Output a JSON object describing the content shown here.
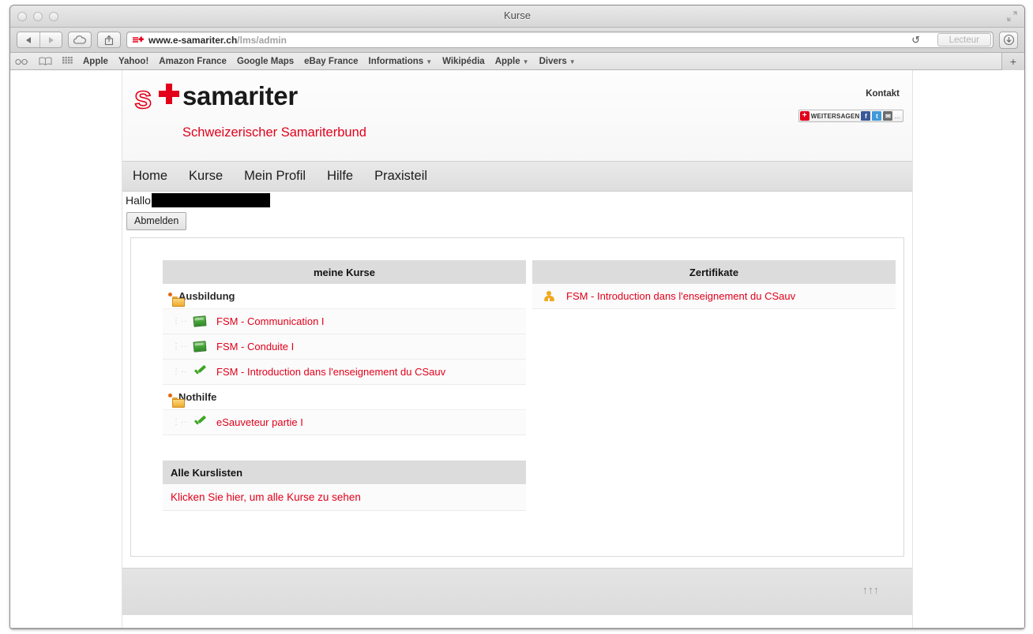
{
  "window": {
    "title": "Kurse",
    "fullscreen_icon": "fullscreen-icon"
  },
  "toolbar": {
    "back_icon": "back-arrow-icon",
    "forward_icon": "forward-arrow-icon",
    "icloud_icon": "cloud-icon",
    "share_icon": "share-icon",
    "url_favicon": "samariter-favicon",
    "url_host": "www.e-samariter.ch",
    "url_path": "/lms/admin",
    "reload_icon": "reload-icon",
    "reader_label": "Lecteur",
    "downloads_icon": "download-icon"
  },
  "bookmarks": {
    "reading_list_icon": "glasses-icon",
    "bookmarks_icon": "book-icon",
    "top_sites_icon": "grid-icon",
    "items": [
      {
        "label": "Apple",
        "has_caret": false
      },
      {
        "label": "Yahoo!",
        "has_caret": false
      },
      {
        "label": "Amazon France",
        "has_caret": false
      },
      {
        "label": "Google Maps",
        "has_caret": false
      },
      {
        "label": "eBay France",
        "has_caret": false
      },
      {
        "label": "Informations",
        "has_caret": true
      },
      {
        "label": "Wikipédia",
        "has_caret": false
      },
      {
        "label": "Apple",
        "has_caret": true
      },
      {
        "label": "Divers",
        "has_caret": true
      }
    ],
    "new_tab_label": "+"
  },
  "site": {
    "logo_letter": "s",
    "logo_word": "samariter",
    "tagline": "Schweizerischer Samariterbund",
    "kontakt_label": "Kontakt",
    "share_widget": {
      "plus": "+",
      "label": "WEITERSAGEN",
      "facebook": "f",
      "twitter": "t",
      "mail": "✉",
      "more": "..."
    },
    "nav": [
      {
        "label": "Home"
      },
      {
        "label": "Kurse"
      },
      {
        "label": "Mein Profil"
      },
      {
        "label": "Hilfe"
      },
      {
        "label": "Praxisteil"
      }
    ],
    "greeting": "Hallo",
    "logout_label": "Abmelden"
  },
  "courses_panel": {
    "header": "meine Kurse",
    "groups": [
      {
        "label": "Ausbildung",
        "icon": "folder-icon",
        "items": [
          {
            "label": "FSM - Communication I",
            "icon": "board-icon"
          },
          {
            "label": "FSM - Conduite I",
            "icon": "board-icon"
          },
          {
            "label": "FSM - Introduction dans l'enseignement du CSauv",
            "icon": "check-icon"
          }
        ]
      },
      {
        "label": "Nothilfe",
        "icon": "folder-icon",
        "items": [
          {
            "label": "eSauveteur partie I",
            "icon": "check-icon"
          }
        ]
      }
    ]
  },
  "certificates_panel": {
    "header": "Zertifikate",
    "items": [
      {
        "label": "FSM - Introduction dans l'enseignement du CSauv",
        "icon": "person-icon"
      }
    ]
  },
  "all_courses": {
    "header": "Alle Kurslisten",
    "link": "Klicken Sie hier, um alle Kurse zu sehen"
  },
  "footer": {
    "top_arrows": "↑↑↑"
  },
  "colors": {
    "brand_red": "#e2001a",
    "link_red": "#e2001a",
    "panel_header_gray": "#dcdcdc",
    "folder_orange": "#eeab2e",
    "check_green": "#3fa524"
  }
}
